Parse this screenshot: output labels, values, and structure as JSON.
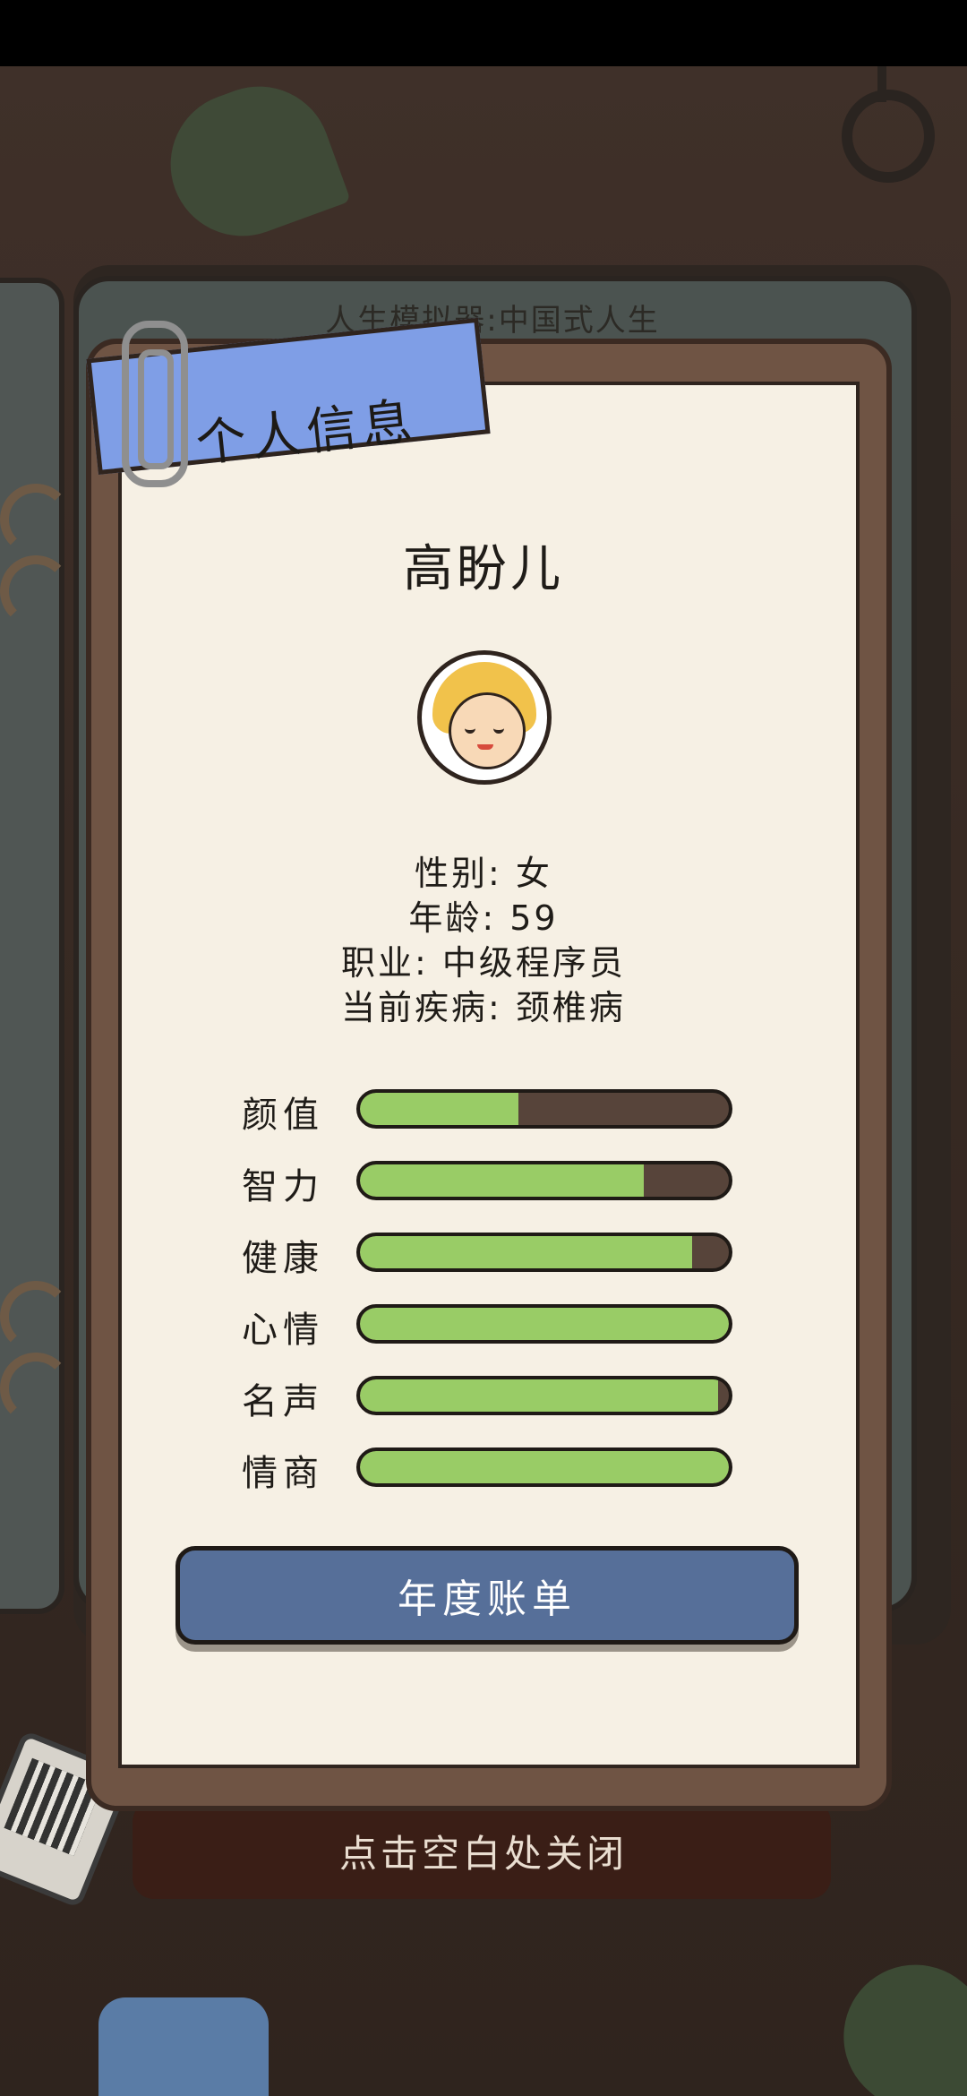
{
  "book": {
    "title": "人生模拟器:中国式人生"
  },
  "card": {
    "header": "个人信息",
    "name": "高盼儿",
    "info": {
      "gender": "性别: 女",
      "age": "年龄: 59",
      "job": "职业: 中级程序员",
      "disease": "当前疾病: 颈椎病"
    },
    "stats": [
      {
        "label": "颜值",
        "value": 0.43
      },
      {
        "label": "智力",
        "value": 0.77
      },
      {
        "label": "健康",
        "value": 0.9
      },
      {
        "label": "心情",
        "value": 1.0
      },
      {
        "label": "名声",
        "value": 0.97
      },
      {
        "label": "情商",
        "value": 1.0
      }
    ],
    "button_label": "年度账单"
  },
  "close_hint": "点击空白处关闭",
  "colors": {
    "bar_fill": "#99cc66",
    "bar_track": "#57443a",
    "ribbon": "#7f9ee6",
    "button": "#566f99"
  }
}
